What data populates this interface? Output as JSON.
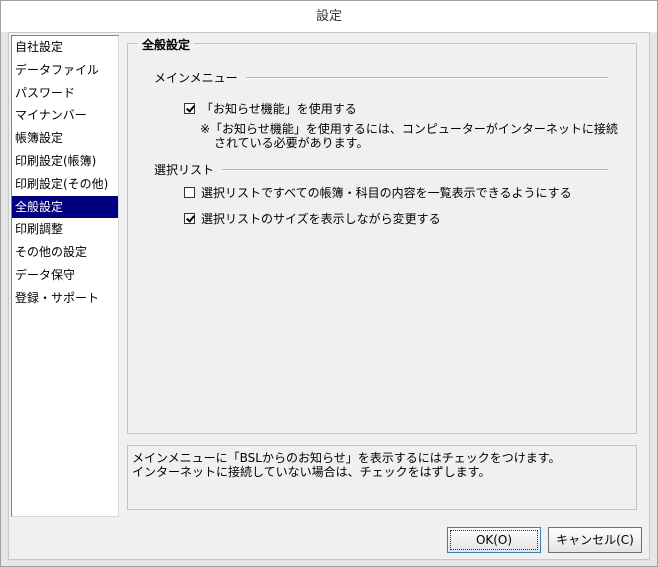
{
  "window": {
    "title": "設定"
  },
  "sidebar": {
    "items": [
      {
        "label": "自社設定"
      },
      {
        "label": "データファイル"
      },
      {
        "label": "パスワード"
      },
      {
        "label": "マイナンバー"
      },
      {
        "label": "帳簿設定"
      },
      {
        "label": "印刷設定(帳簿)"
      },
      {
        "label": "印刷設定(その他)"
      },
      {
        "label": "全般設定",
        "selected": true
      },
      {
        "label": "印刷調整"
      },
      {
        "label": "その他の設定"
      },
      {
        "label": "データ保守"
      },
      {
        "label": "登録・サポート"
      }
    ]
  },
  "panel": {
    "title": "全般設定",
    "main_menu": {
      "heading": "メインメニュー",
      "option": {
        "label": "「お知らせ機能」を使用する",
        "checked": true
      },
      "note_line1": "※「お知らせ機能」を使用するには、コンピューターがインターネットに接続",
      "note_line2": "されている必要があります。"
    },
    "select_list": {
      "heading": "選択リスト",
      "option1": {
        "label": "選択リストですべての帳簿・科目の内容を一覧表示できるようにする",
        "checked": false
      },
      "option2": {
        "label": "選択リストのサイズを表示しながら変更する",
        "checked": true
      }
    }
  },
  "description": {
    "line1": "メインメニューに「BSLからのお知らせ」を表示するにはチェックをつけます。",
    "line2": "インターネットに接続していない場合は、チェックをはずします。"
  },
  "buttons": {
    "ok": "OK(O)",
    "cancel": "キャンセル(C)"
  }
}
